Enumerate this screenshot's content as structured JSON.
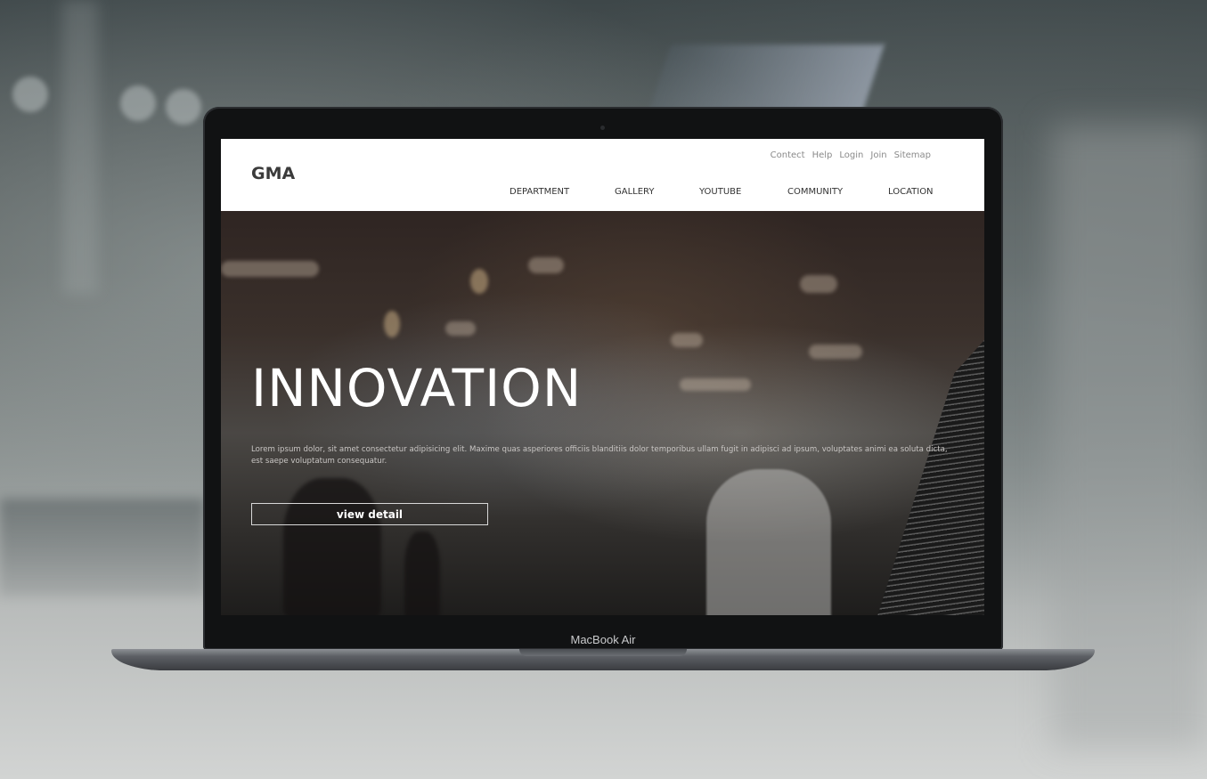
{
  "site": {
    "logo": "GMA",
    "utility_nav": [
      "Contect",
      "Help",
      "Login",
      "Join",
      "Sitemap"
    ],
    "main_nav": [
      "DEPARTMENT",
      "GALLERY",
      "YOUTUBE",
      "COMMUNITY",
      "LOCATION"
    ]
  },
  "hero": {
    "title": "INNOVATION",
    "text": "Lorem ipsum dolor, sit amet consectetur adipisicing elit. Maxime quas asperiores officiis blanditiis dolor temporibus ullam fugit in adipisci ad ipsum, voluptates animi ea soluta dicta, est saepe voluptatum consequatur.",
    "button_label": "view detail"
  },
  "device": {
    "label": "MacBook Air"
  }
}
